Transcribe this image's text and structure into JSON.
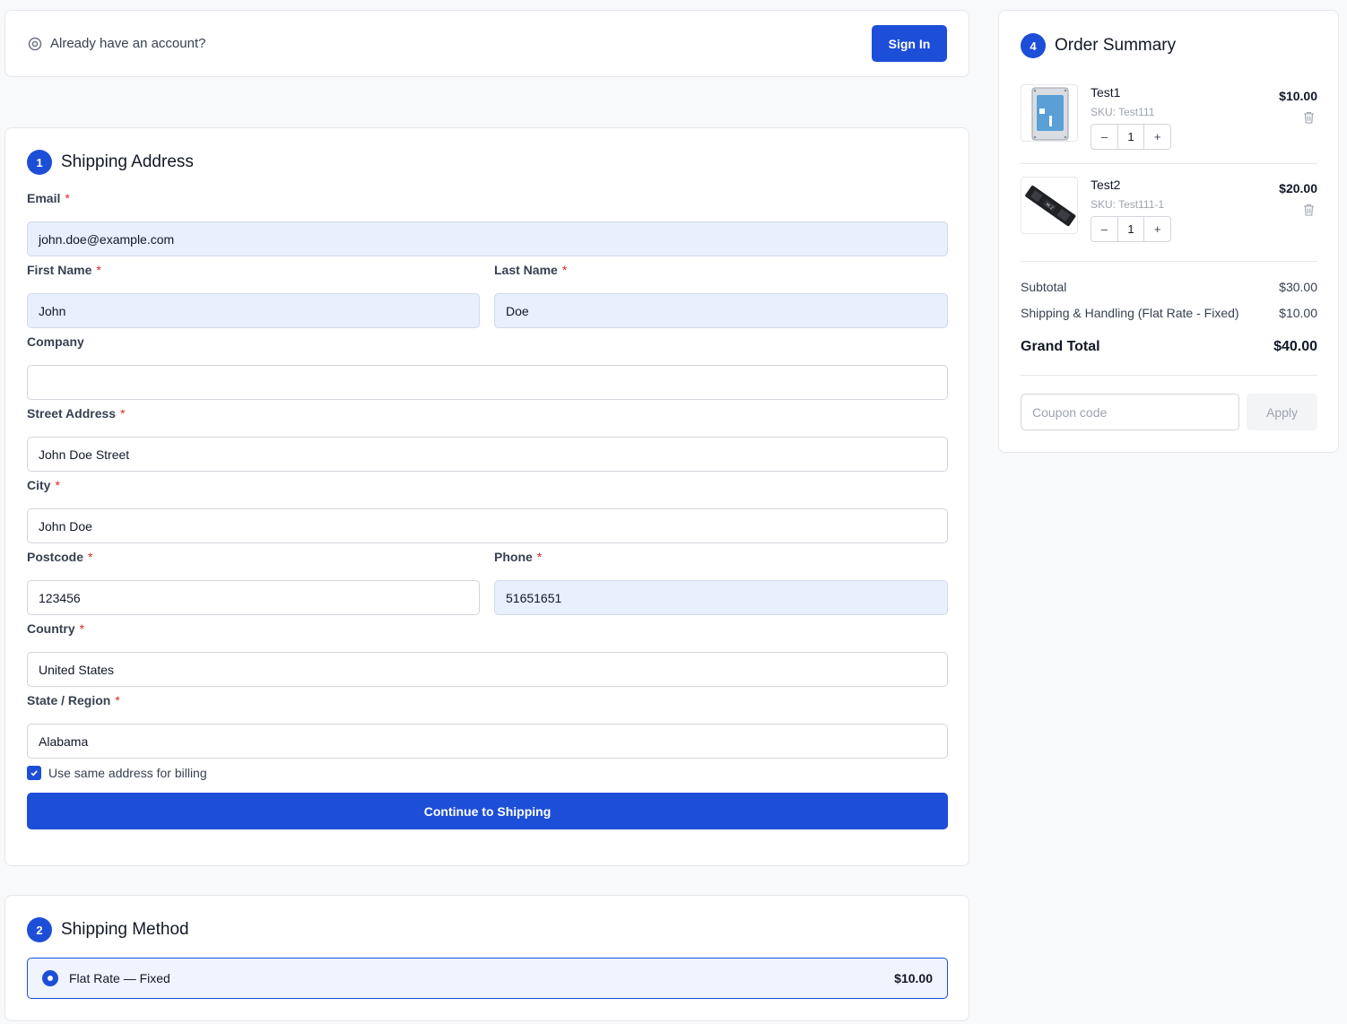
{
  "signin": {
    "text": "Already have an account?",
    "button": "Sign In",
    "icon": "location-ring-icon"
  },
  "address": {
    "step": "1",
    "title": "Shipping Address",
    "fields": {
      "email": {
        "label": "Email",
        "value": "john.doe@example.com"
      },
      "first_name": {
        "label": "First Name",
        "value": "John"
      },
      "last_name": {
        "label": "Last Name",
        "value": "Doe"
      },
      "company": {
        "label": "Company",
        "value": ""
      },
      "street": {
        "label": "Street Address",
        "value": "John Doe Street"
      },
      "city": {
        "label": "City",
        "value": "John Doe"
      },
      "postcode": {
        "label": "Postcode",
        "value": "123456"
      },
      "phone": {
        "label": "Phone",
        "value": "51651651"
      },
      "country": {
        "label": "Country",
        "value": "United States"
      },
      "state": {
        "label": "State / Region",
        "value": "Alabama"
      }
    },
    "required_mark": "*",
    "billing_checkbox": {
      "label": "Use same address for billing",
      "checked": true
    },
    "continue_button": "Continue to Shipping"
  },
  "method": {
    "step": "2",
    "title": "Shipping Method",
    "option": {
      "label": "Flat Rate — Fixed",
      "price": "$10.00",
      "selected": true
    }
  },
  "summary": {
    "step": "4",
    "title": "Order Summary",
    "items": [
      {
        "name": "Test1",
        "sku": "SKU: Test111",
        "price": "$10.00",
        "qty": "1",
        "minus": "–",
        "plus": "+"
      },
      {
        "name": "Test2",
        "sku": "SKU: Test111-1",
        "price": "$20.00",
        "qty": "1",
        "minus": "–",
        "plus": "+"
      }
    ],
    "subtotal": {
      "label": "Subtotal",
      "value": "$30.00"
    },
    "shipping": {
      "label": "Shipping & Handling (Flat Rate - Fixed)",
      "value": "$10.00"
    },
    "grand_total": {
      "label": "Grand Total",
      "value": "$40.00"
    },
    "coupon_placeholder": "Coupon code",
    "apply_button": "Apply"
  },
  "colors": {
    "accent": "#1d4ed8",
    "required": "#dc2626",
    "autofill": "#e8effd"
  }
}
